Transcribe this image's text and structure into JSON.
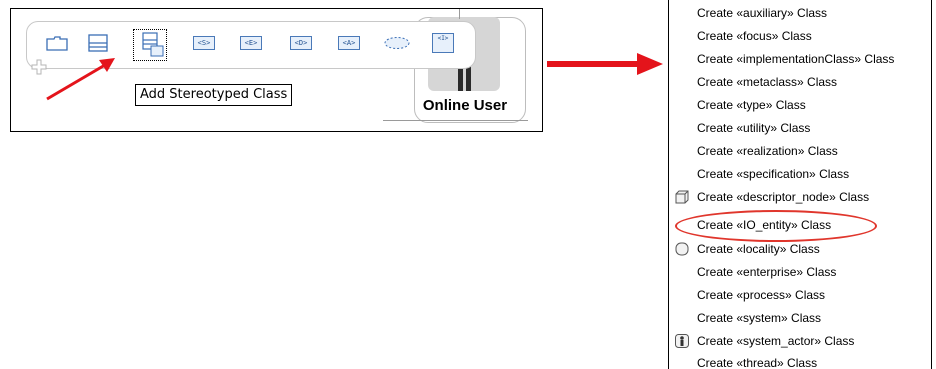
{
  "left_panel": {
    "tooltip": "Add Stereotyped Class",
    "element_label": "Online User",
    "toolbar": {
      "stereotype_buttons": [
        "<S>",
        "<E>",
        "<D>",
        "<A>",
        "<I>"
      ]
    }
  },
  "right_panel": {
    "menu_items": [
      {
        "label": "Create «auxiliary» Class",
        "icon": ""
      },
      {
        "label": "Create «focus» Class",
        "icon": ""
      },
      {
        "label": "Create «implementationClass» Class",
        "icon": ""
      },
      {
        "label": "Create «metaclass» Class",
        "icon": ""
      },
      {
        "label": "Create «type» Class",
        "icon": ""
      },
      {
        "label": "Create «utility» Class",
        "icon": ""
      },
      {
        "label": "Create «realization» Class",
        "icon": ""
      },
      {
        "label": "Create «specification» Class",
        "icon": ""
      },
      {
        "label": "Create «descriptor_node» Class",
        "icon": "node-icon"
      },
      {
        "label": "Create «IO_entity» Class",
        "icon": ""
      },
      {
        "label": "Create «locality» Class",
        "icon": "locality-icon"
      },
      {
        "label": "Create «enterprise» Class",
        "icon": ""
      },
      {
        "label": "Create «process» Class",
        "icon": ""
      },
      {
        "label": "Create «system» Class",
        "icon": ""
      },
      {
        "label": "Create «system_actor» Class",
        "icon": "actor-icon"
      },
      {
        "label": "Create «thread» Class",
        "icon": ""
      }
    ]
  },
  "colors": {
    "arrow": "#e4141b",
    "highlight": "#e0362c",
    "toolbar_icon": "#3a6eb5"
  }
}
